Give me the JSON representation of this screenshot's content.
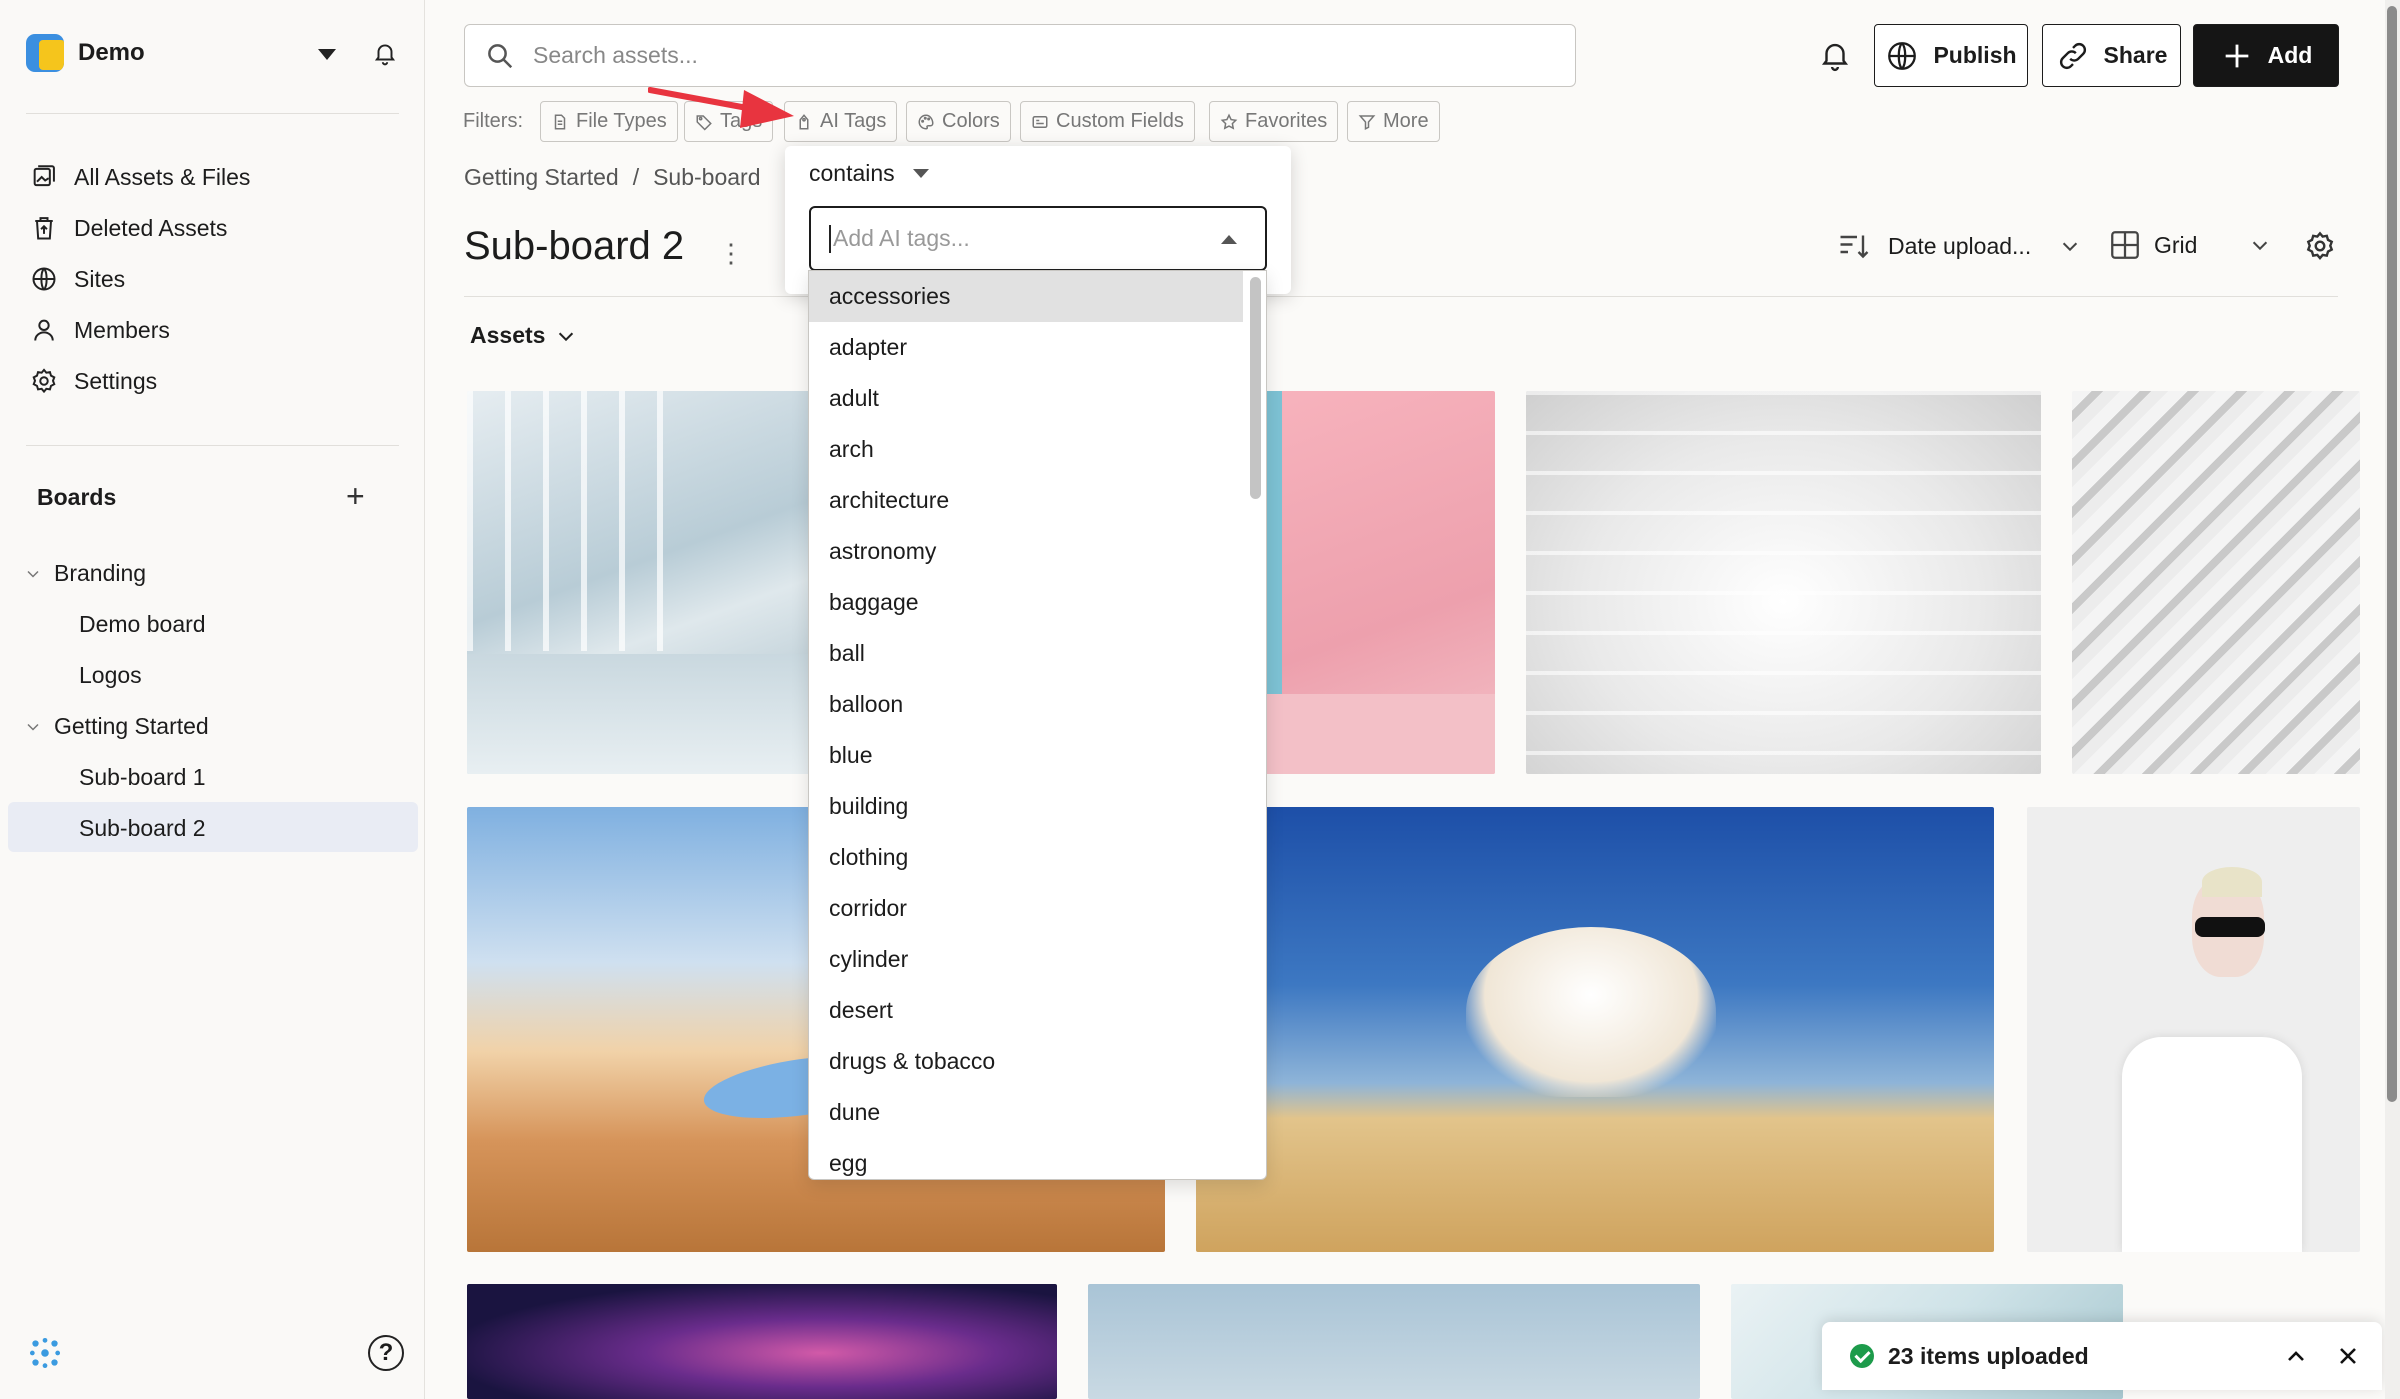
{
  "workspace": {
    "name": "Demo"
  },
  "sidebar": {
    "nav": [
      {
        "label": "All Assets & Files",
        "icon": "assets-icon"
      },
      {
        "label": "Deleted Assets",
        "icon": "trash-icon"
      },
      {
        "label": "Sites",
        "icon": "globe-icon"
      },
      {
        "label": "Members",
        "icon": "user-icon"
      },
      {
        "label": "Settings",
        "icon": "gear-icon"
      }
    ],
    "boards_heading": "Boards",
    "tree": [
      {
        "label": "Branding"
      },
      {
        "label": "Demo board"
      },
      {
        "label": "Logos"
      },
      {
        "label": "Getting Started"
      },
      {
        "label": "Sub-board 1"
      },
      {
        "label": "Sub-board 2"
      }
    ]
  },
  "search": {
    "placeholder": "Search assets..."
  },
  "toolbar": {
    "publish": "Publish",
    "share": "Share",
    "add": "Add"
  },
  "filters": {
    "label": "Filters:",
    "chips": [
      "File Types",
      "Tags",
      "AI Tags",
      "Colors",
      "Custom Fields",
      "Favorites",
      "More"
    ]
  },
  "breadcrumb": [
    "Getting Started",
    "/",
    "Sub-board"
  ],
  "page": {
    "title": "Sub-board 2"
  },
  "view": {
    "sort": "Date upload...",
    "layout": "Grid"
  },
  "assets_toggle": "Assets",
  "ai_tags": {
    "operator": "contains",
    "placeholder": "Add AI tags...",
    "options": [
      "accessories",
      "adapter",
      "adult",
      "arch",
      "architecture",
      "astronomy",
      "baggage",
      "ball",
      "balloon",
      "blue",
      "building",
      "clothing",
      "corridor",
      "cylinder",
      "desert",
      "drugs & tobacco",
      "dune",
      "egg"
    ]
  },
  "toast": {
    "text": "23 items uploaded"
  },
  "colors": {
    "accent": "#151515",
    "highlight": "#e9ecf4",
    "arrow": "#e8343f",
    "success": "#1d9b4b"
  }
}
